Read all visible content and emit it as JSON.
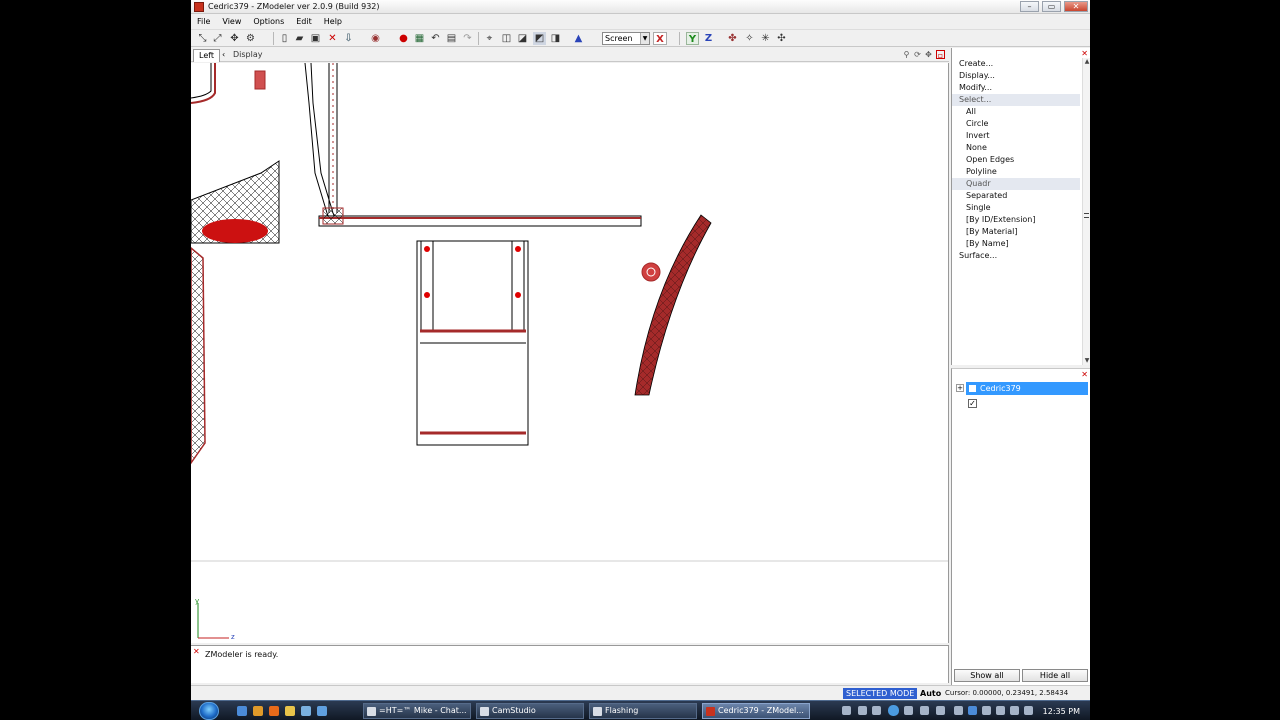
{
  "window": {
    "title": "Cedric379 - ZModeler ver 2.0.9 (Build 932)",
    "minimize": "–",
    "maximize": "▭",
    "close": "✕"
  },
  "menu": [
    "File",
    "View",
    "Options",
    "Edit",
    "Help"
  ],
  "toolbar": {
    "screen_select": "Screen",
    "axis_y": "Y",
    "axis_z": "Z",
    "axis_x": "X"
  },
  "viewport": {
    "tab": "Left",
    "display_label": "Display",
    "axis_y": "y",
    "axis_z": "z"
  },
  "log": {
    "message": "ZModeler is ready."
  },
  "commands": {
    "items": [
      {
        "label": "Create...",
        "level": 0
      },
      {
        "label": "Display...",
        "level": 0
      },
      {
        "label": "Modify...",
        "level": 0
      },
      {
        "label": "Select...",
        "level": 0,
        "highlight": true
      },
      {
        "label": "All",
        "level": 1
      },
      {
        "label": "Circle",
        "level": 1
      },
      {
        "label": "Invert",
        "level": 1
      },
      {
        "label": "None",
        "level": 1
      },
      {
        "label": "Open Edges",
        "level": 1
      },
      {
        "label": "Polyline",
        "level": 1
      },
      {
        "label": "Quadr",
        "level": 1,
        "highlight": true
      },
      {
        "label": "Separated",
        "level": 1
      },
      {
        "label": "Single",
        "level": 1
      },
      {
        "label": "[By ID/Extension]",
        "level": 1
      },
      {
        "label": "[By Material]",
        "level": 1
      },
      {
        "label": "[By Name]",
        "level": 1
      },
      {
        "label": "Surface...",
        "level": 0
      }
    ]
  },
  "scene": {
    "root": "Cedric379",
    "show_all": "Show all",
    "hide_all": "Hide all"
  },
  "status": {
    "mode": "SELECTED MODE",
    "auto": "Auto",
    "cursor": "Cursor: 0.00000, 0.23491, 2.58434"
  },
  "taskbar": {
    "tasks": [
      {
        "label": "=HT=™ Mike - Chat...",
        "active": false
      },
      {
        "label": "CamStudio",
        "active": false
      },
      {
        "label": "Flashing",
        "active": false
      },
      {
        "label": "Cedric379 - ZModel...",
        "active": true
      }
    ],
    "clock": "12:35 PM"
  },
  "colors": {
    "mesh_fill": "#a52a2a",
    "mesh_vertex": "#e00000",
    "selection": "#3399ff",
    "status_badge": "#2f5fd0"
  }
}
